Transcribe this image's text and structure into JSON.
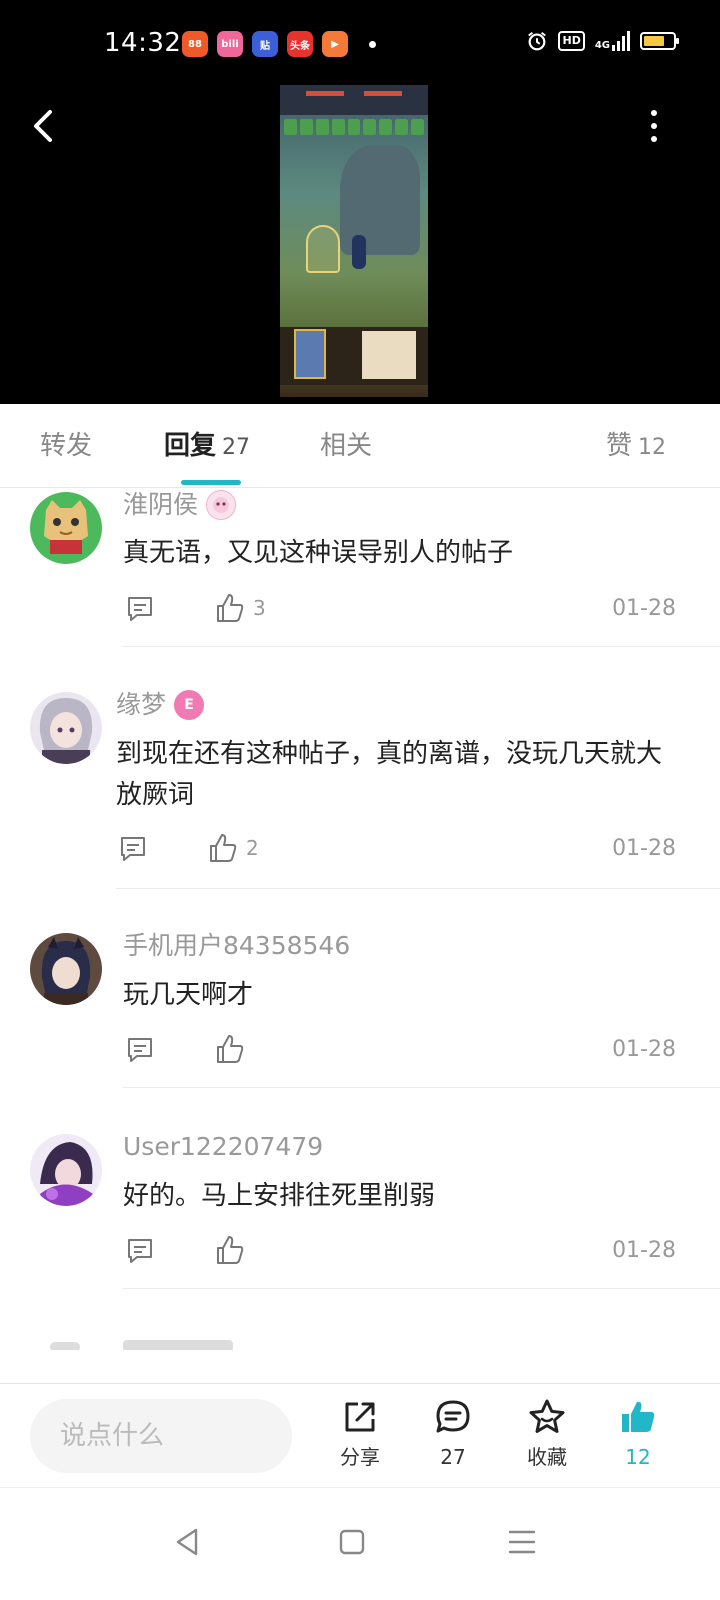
{
  "status_bar": {
    "time": "14:32",
    "apps": [
      {
        "icon": "grid-app-icon",
        "text": "88",
        "color": "#f05a28"
      },
      {
        "icon": "bilibili-icon",
        "text": "bili",
        "color": "#f0679a"
      },
      {
        "icon": "tieba-icon",
        "text": "贴",
        "color": "#3a5fd9"
      },
      {
        "icon": "toutiao-icon",
        "text": "头条",
        "color": "#e8322d"
      },
      {
        "icon": "game-icon",
        "text": "▶",
        "color": "#f47a3a"
      }
    ],
    "hd_label": "HD",
    "network": "4G",
    "battery_level": 0.7
  },
  "tabs": [
    {
      "label": "转发",
      "count": ""
    },
    {
      "label": "回复",
      "count": "27"
    },
    {
      "label": "相关",
      "count": ""
    },
    {
      "label": "赞",
      "count": "12"
    }
  ],
  "active_tab": "回复",
  "comments": [
    {
      "user": "淮阴侯",
      "badge": "pink-anime-badge",
      "text": "真无语，又见这种误导别人的帖子",
      "likes": "3",
      "date": "01-28"
    },
    {
      "user": "缘梦",
      "badge_text": "E",
      "badge_color": "#f07ab2",
      "text": "到现在还有这种帖子，真的离谱，没玩几天就大放厥词",
      "likes": "2",
      "date": "01-28"
    },
    {
      "user": "手机用户84358546",
      "text": "玩几天啊才",
      "likes": "",
      "date": "01-28"
    },
    {
      "user": "User122207479",
      "text": "好的。马上安排往死里削弱",
      "likes": "",
      "date": "01-28"
    }
  ],
  "bottom_bar": {
    "input_placeholder": "说点什么",
    "share_label": "分享",
    "reply_count": "27",
    "favorite_label": "收藏",
    "like_count": "12",
    "accent_color": "#21b7c6"
  }
}
